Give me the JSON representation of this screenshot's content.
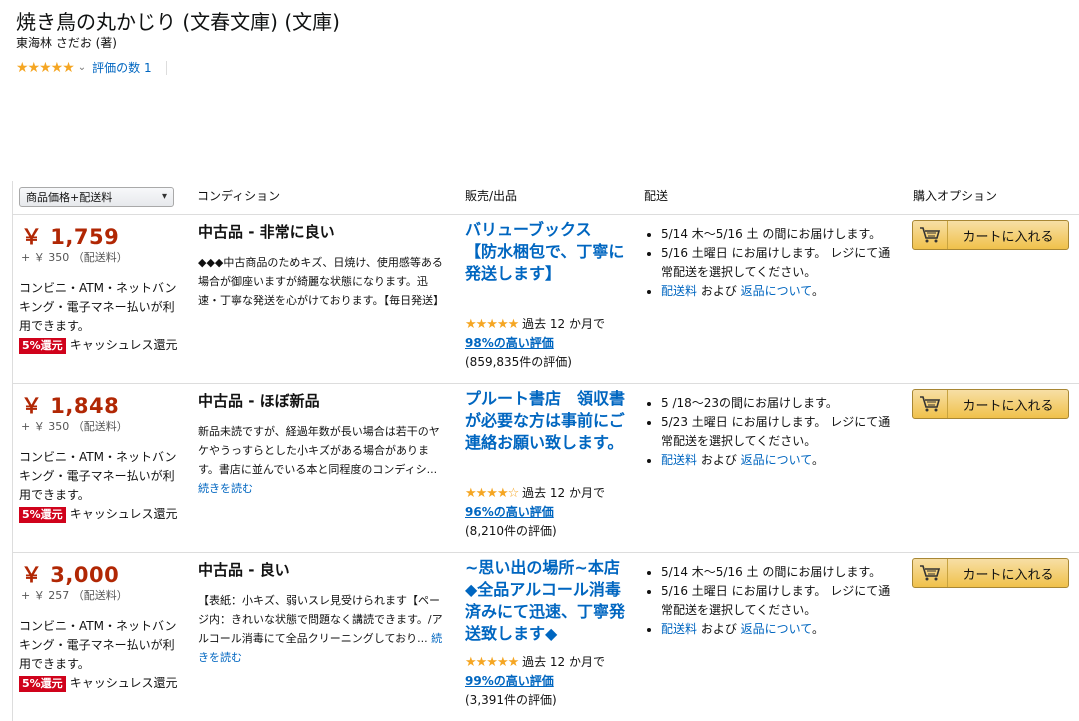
{
  "product": {
    "title": "焼き鳥の丸かじり (文春文庫) (文庫)",
    "author": "東海林 さだお (著)",
    "stars": "★★★★★",
    "rating_link": "評価の数 1"
  },
  "table_header": {
    "sort_select": "商品価格+配送料",
    "condition": "コンディション",
    "seller": "販売/出品",
    "delivery": "配送",
    "buy": "購入オプション"
  },
  "offers": [
    {
      "price": "￥ 1,759",
      "shipping": "+ ￥ 350 （配送料）",
      "payment": "コンビニ・ATM・ネットバンキング・電子マネー払いが利用できます。",
      "badge": "5%還元",
      "cashless": "キャッシュレス還元",
      "condition": "中古品 - 非常に良い",
      "condition_desc": "◆◆◆中古商品のためキズ、日焼け、使用感等ある場合が御座いますが綺麗な状態になります。迅速・丁寧な発送を心がけております。【毎日発送】",
      "read_more": "",
      "seller_name": "バリューブックス　　【防水梱包で、丁寧に発送します】",
      "seller_stars": "★★★★★",
      "seller_rating_text": "過去 12 か月で",
      "seller_positive": "98%の高い評価",
      "seller_count": "(859,835件の評価)",
      "delivery_1": "5/14 木～5/16 土 の間にお届けします。",
      "delivery_2": "5/16 土曜日 にお届けします。 レジにて通常配送を選択してください。",
      "delivery_link_1": "配送料",
      "delivery_and": " および ",
      "delivery_link_2": "返品について",
      "delivery_end": "。",
      "cart_label": "カートに入れる"
    },
    {
      "price": "￥ 1,848",
      "shipping": "+ ￥ 350 （配送料）",
      "payment": "コンビニ・ATM・ネットバンキング・電子マネー払いが利用できます。",
      "badge": "5%還元",
      "cashless": "キャッシュレス還元",
      "condition": "中古品 - ほぼ新品",
      "condition_desc": "新品未読ですが、経過年数が長い場合は若干のヤケやうっすらとした小キズがある場合があります。書店に並んでいる本と同程度のコンディシ... ",
      "read_more": "続きを読む",
      "seller_name": "プルート書店　領収書が必要な方は事前にご連絡お願い致します。",
      "seller_stars": "★★★★☆",
      "seller_rating_text": "過去 12 か月で",
      "seller_positive": "96%の高い評価",
      "seller_count": "(8,210件の評価)",
      "delivery_1": "5 /18～23の間にお届けします。",
      "delivery_2": "5/23 土曜日 にお届けします。 レジにて通常配送を選択してください。",
      "delivery_link_1": "配送料",
      "delivery_and": " および ",
      "delivery_link_2": "返品について",
      "delivery_end": "。",
      "cart_label": "カートに入れる"
    },
    {
      "price": "￥ 3,000",
      "shipping": "+ ￥ 257 （配送料）",
      "payment": "コンビニ・ATM・ネットバンキング・電子マネー払いが利用できます。",
      "badge": "5%還元",
      "cashless": "キャッシュレス還元",
      "condition": "中古品 - 良い",
      "condition_desc": "【表紙：小キズ、弱いスレ見受けられます【ページ内：きれいな状態で問題なく講読できます。/アルコール消毒にて全品クリーニングしており... ",
      "read_more": "続きを読む",
      "seller_name": "~思い出の場所~本店 ◆全品アルコール消毒済みにて迅速、丁寧発送致します◆",
      "seller_stars": "★★★★★",
      "seller_rating_text": "過去 12 か月で",
      "seller_positive": "99%の高い評価",
      "seller_count": "(3,391件の評価)",
      "delivery_1": "5/14 木～5/16 土 の間にお届けします。",
      "delivery_2": "5/16 土曜日 にお届けします。 レジにて通常配送を選択してください。",
      "delivery_link_1": "配送料",
      "delivery_and": " および ",
      "delivery_link_2": "返品について",
      "delivery_end": "。",
      "cart_label": "カートに入れる"
    }
  ],
  "colors": {
    "price": "#b12704",
    "link": "#0066c0",
    "star": "#f5a623",
    "badge": "#d0021b",
    "button": "#f0c14b"
  },
  "icons": {
    "cart": "cart-icon",
    "chevron": "chevron-down-icon",
    "star": "star-icon"
  }
}
